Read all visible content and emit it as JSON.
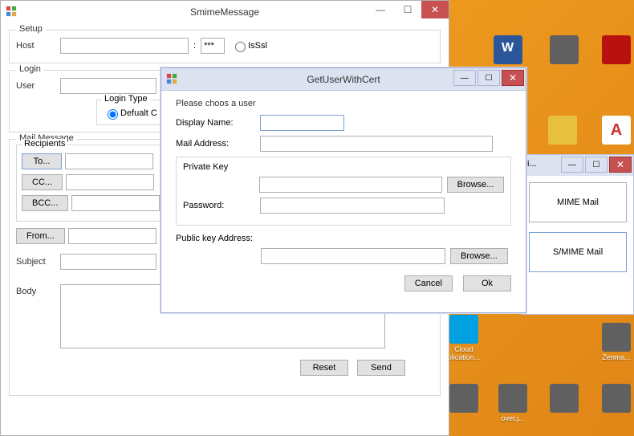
{
  "bgWindow": {
    "title": "SmimeMessage",
    "setup": {
      "legend": "Setup",
      "hostLabel": "Host",
      "hostValue": "",
      "portSep": ":",
      "portValue": "***",
      "isSslLabel": "IsSsl"
    },
    "login": {
      "legend": "Login",
      "userLabel": "User",
      "userValue": "",
      "loginTypeLabel": "Login Type",
      "defaultLabel": "Defualt C"
    },
    "mail": {
      "legend": "Mail Message",
      "recipientsLegend": "Recipients",
      "toLabel": "To...",
      "ccLabel": "CC...",
      "bccLabel": "BCC...",
      "fromLabel": "From...",
      "subjectLabel": "Subject",
      "bodyLabel": "Body",
      "resetLabel": "Reset",
      "sendLabel": "Send"
    }
  },
  "dialog": {
    "title": "GetUserWithCert",
    "instruction": "Please choos a user",
    "displayNameLabel": "Display Name:",
    "displayNameValue": "",
    "mailAddressLabel": "Mail Address:",
    "mailAddressValue": "",
    "pkLegend": "Private Key",
    "pkPathValue": "",
    "pkBrowseLabel": "Browse...",
    "passwordLabel": "Password:",
    "passwordValue": "",
    "pubLabel": "Public  key Address:",
    "pubValue": "",
    "pubBrowseLabel": "Browse...",
    "cancelLabel": "Cancel",
    "okLabel": "Ok"
  },
  "rightWindow": {
    "titleSuffix": "i...",
    "mimeLabel": "MIME Mail",
    "smimeLabel": "S/MIME Mail"
  },
  "desktop": {
    "cloudLabel": "Cloud plication...",
    "zenmaLabel": "Zenma...",
    "overLabel": "over.j..."
  }
}
